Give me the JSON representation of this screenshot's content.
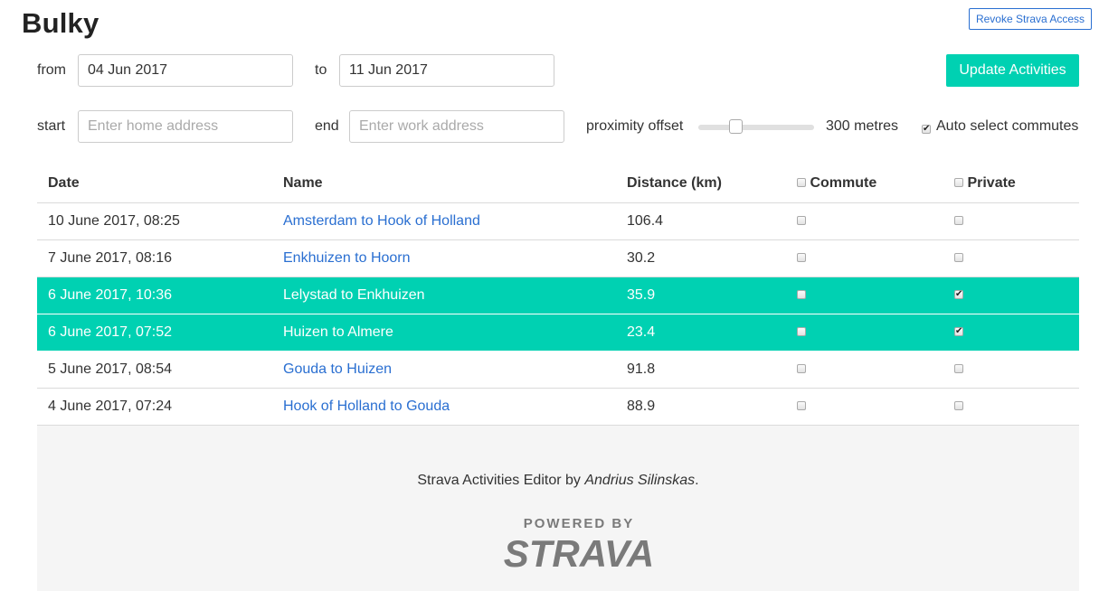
{
  "app": {
    "title": "Bulky"
  },
  "header": {
    "revoke_label": "Revoke Strava Access"
  },
  "dates": {
    "from_label": "from",
    "from_value": "04 Jun 2017",
    "to_label": "to",
    "to_value": "11 Jun 2017"
  },
  "update_label": "Update Activities",
  "addresses": {
    "start_label": "start",
    "start_placeholder": "Enter home address",
    "end_label": "end",
    "end_placeholder": "Enter work address"
  },
  "proximity": {
    "label": "proximity offset",
    "value_text": "300 metres",
    "level_fraction": 0.3
  },
  "auto_select": {
    "label": "Auto select commutes",
    "checked": true
  },
  "table": {
    "headers": {
      "date": "Date",
      "name": "Name",
      "distance": "Distance (km)",
      "commute": "Commute",
      "private": "Private"
    },
    "rows": [
      {
        "date": "10 June 2017, 08:25",
        "name": "Amsterdam to Hook of Holland",
        "distance": "106.4",
        "commute": false,
        "private": false,
        "selected": false
      },
      {
        "date": "7 June 2017, 08:16",
        "name": "Enkhuizen to Hoorn",
        "distance": "30.2",
        "commute": false,
        "private": false,
        "selected": false
      },
      {
        "date": "6 June 2017, 10:36",
        "name": "Lelystad to Enkhuizen",
        "distance": "35.9",
        "commute": false,
        "private": true,
        "selected": true
      },
      {
        "date": "6 June 2017, 07:52",
        "name": "Huizen to Almere",
        "distance": "23.4",
        "commute": false,
        "private": true,
        "selected": true
      },
      {
        "date": "5 June 2017, 08:54",
        "name": "Gouda to Huizen",
        "distance": "91.8",
        "commute": false,
        "private": false,
        "selected": false
      },
      {
        "date": "4 June 2017, 07:24",
        "name": "Hook of Holland to Gouda",
        "distance": "88.9",
        "commute": false,
        "private": false,
        "selected": false
      }
    ]
  },
  "footer": {
    "text_prefix": "Strava Activities Editor by ",
    "author": "Andrius Silinskas",
    "text_suffix": ".",
    "powered_by": "POWERED BY",
    "logo_text": "STRAVA"
  },
  "colors": {
    "accent": "#00d1b2",
    "link": "#2a6fd1",
    "footer_bg": "#f5f5f5"
  }
}
